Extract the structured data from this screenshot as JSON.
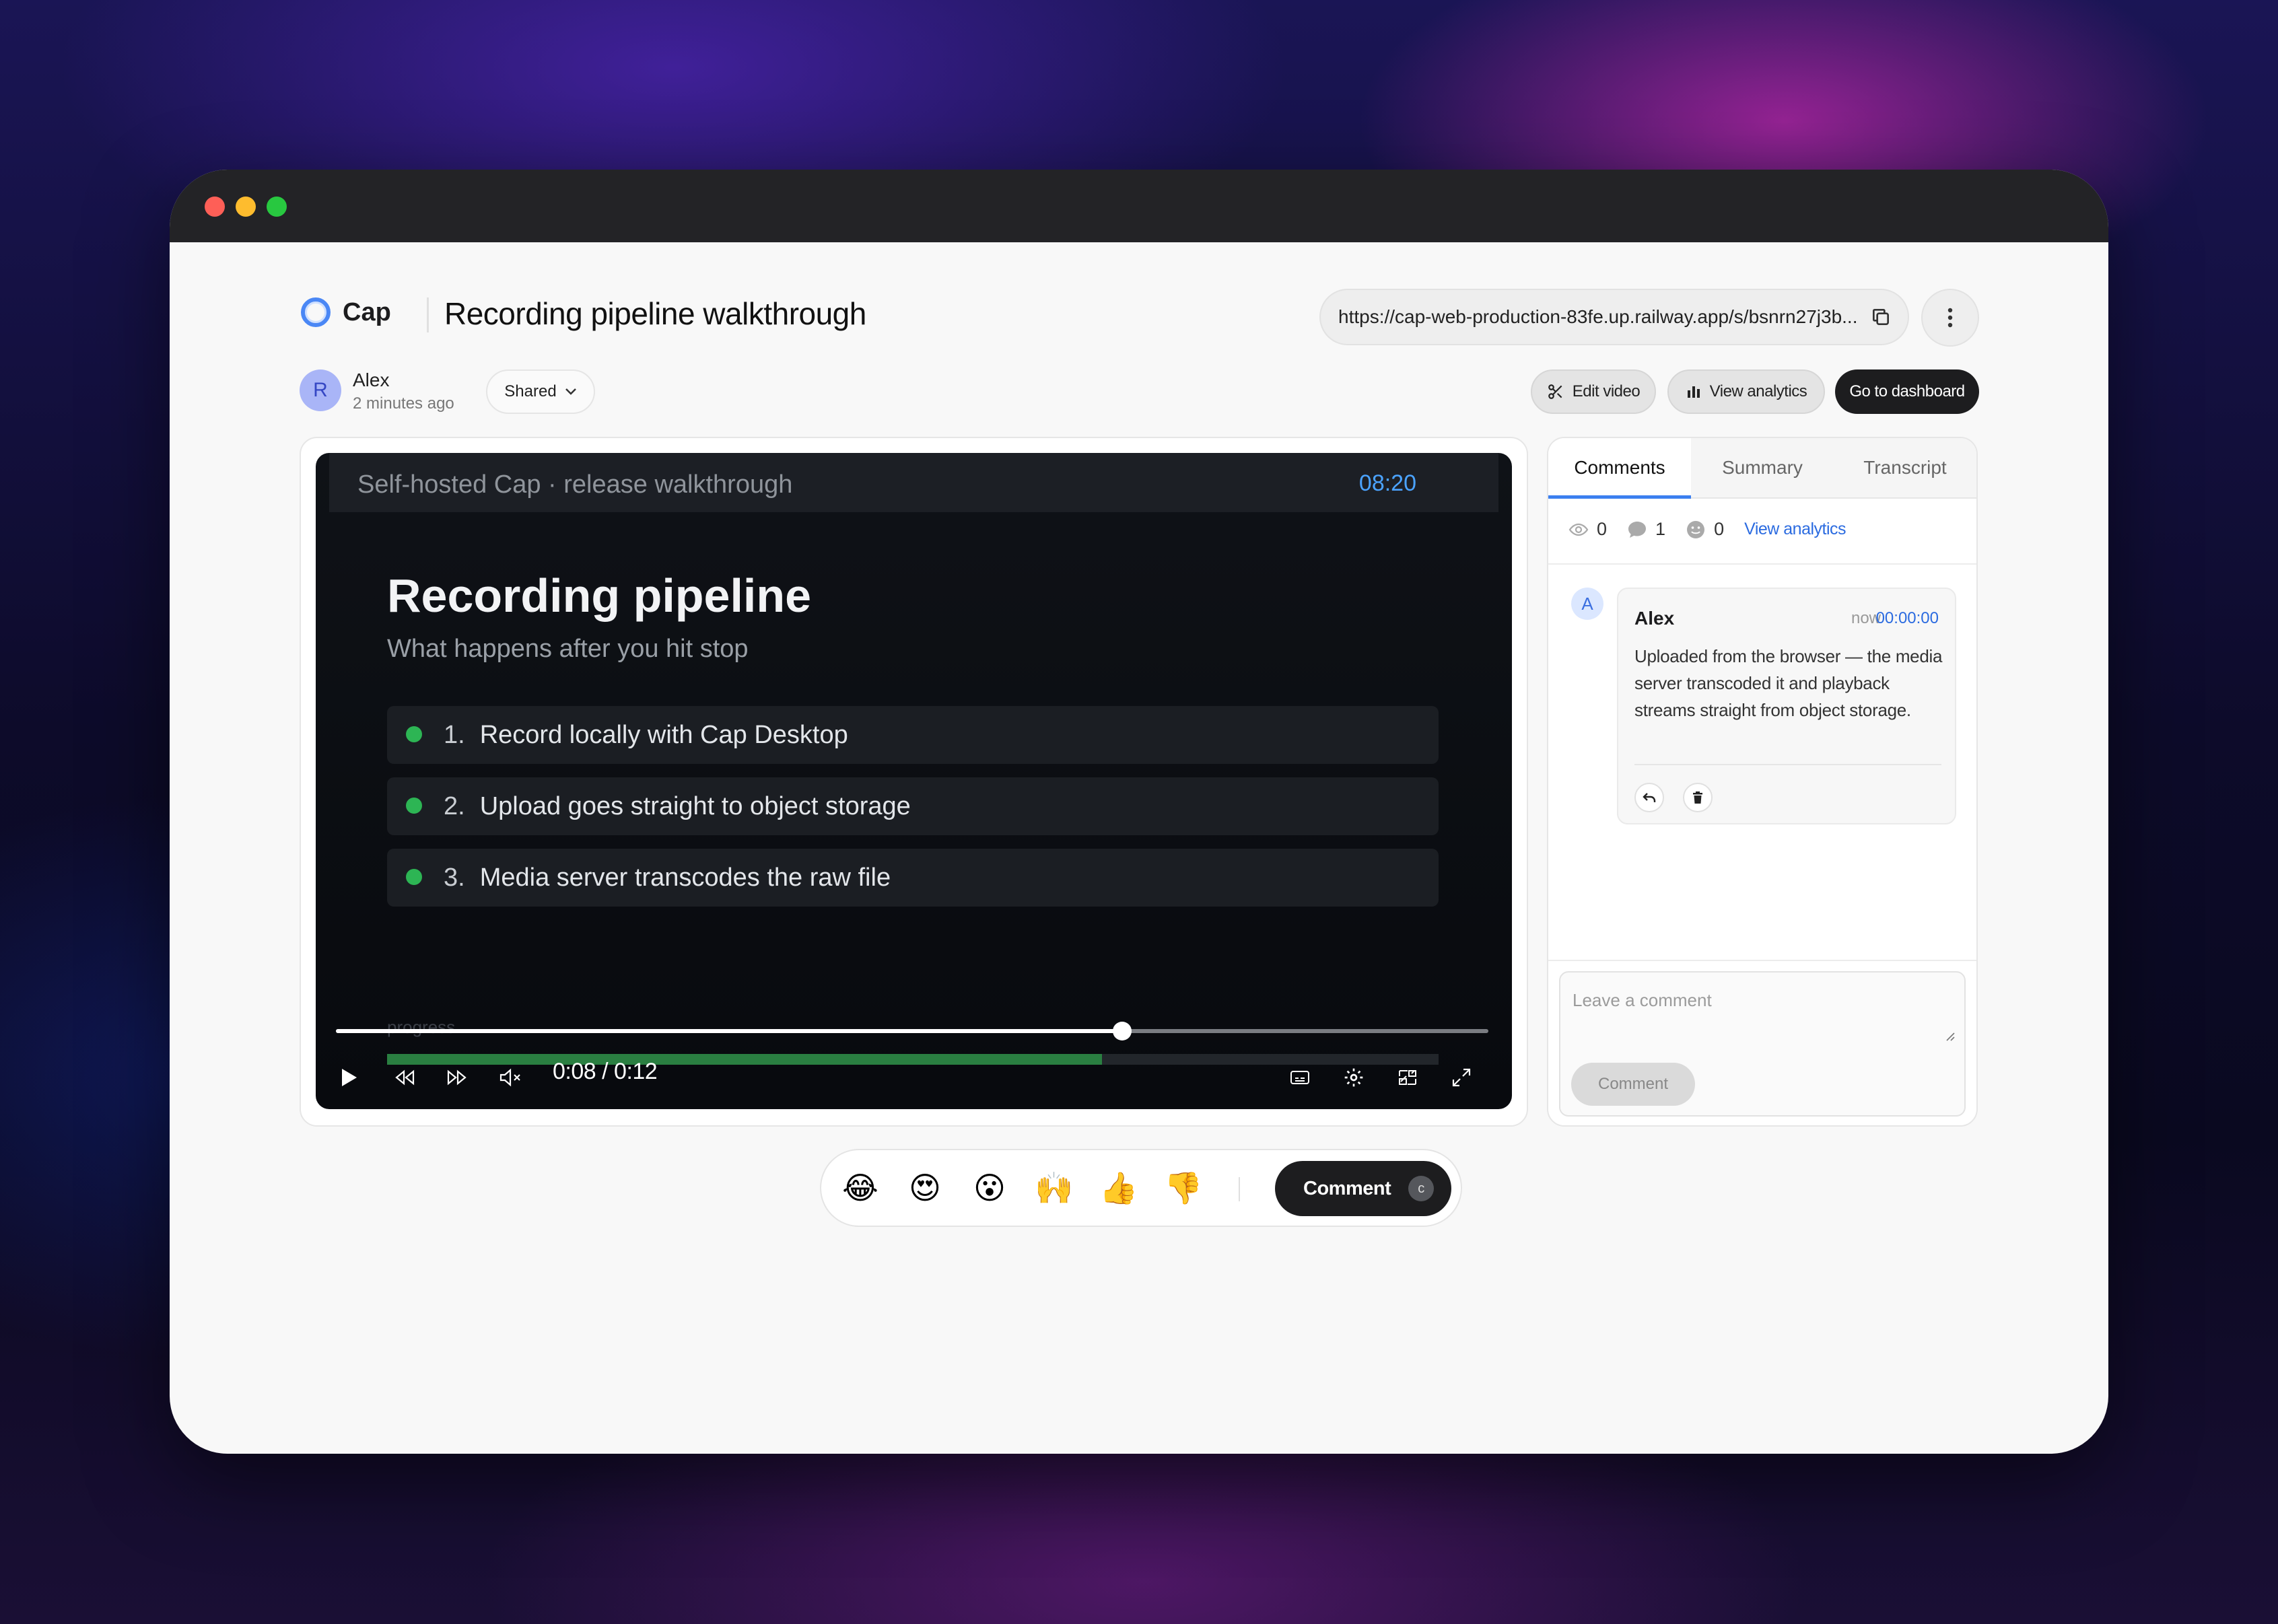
{
  "app": {
    "logo_text": "Cap",
    "page_title": "Recording pipeline walkthrough",
    "share_url": "https://cap-web-production-83fe.up.railway.app/s/bsnrn27j3b..."
  },
  "author": {
    "avatar_initial": "R",
    "name": "Alex",
    "time": "2 minutes ago",
    "visibility_label": "Shared"
  },
  "toolbar": {
    "edit_label": "Edit video",
    "analytics_label": "View analytics",
    "dashboard_label": "Go to dashboard"
  },
  "video": {
    "top_left": "Self-hosted Cap  ·  release walkthrough",
    "top_right": "08:20",
    "slide_title": "Recording pipeline",
    "slide_subtitle": "What happens after you hit stop",
    "steps": [
      {
        "num": "1.",
        "text": "Record locally with Cap Desktop"
      },
      {
        "num": "2.",
        "text": "Upload goes straight to object storage"
      },
      {
        "num": "3.",
        "text": "Media server transcodes the raw file"
      }
    ],
    "progress_label": "progress",
    "slide_progress_fraction": 0.68,
    "current_time": "0:08",
    "duration": "0:12",
    "time_separator": " / ",
    "playback_fraction": 0.682
  },
  "panel": {
    "tabs": [
      {
        "label": "Comments"
      },
      {
        "label": "Summary"
      },
      {
        "label": "Transcript"
      }
    ],
    "stats": {
      "views": "0",
      "comments": "1",
      "reactions": "0",
      "analytics_link": "View analytics"
    },
    "comment": {
      "avatar_initial": "A",
      "author": "Alex",
      "when": "now",
      "timestamp": "00:00:00",
      "body": "Uploaded from the browser — the media server transcoded it and playback streams straight from object storage."
    },
    "compose": {
      "placeholder": "Leave a comment",
      "button_label": "Comment"
    }
  },
  "reactions": {
    "emojis": [
      "😂",
      "😍",
      "😮",
      "🙌",
      "👍",
      "👎"
    ],
    "comment_label": "Comment",
    "comment_shortcut": "c"
  },
  "colors": {
    "accent": "#3b7ff0",
    "link": "#2b6be0",
    "slide_bullet": "#2db554",
    "timestamp_blue": "#4ba3ff"
  }
}
